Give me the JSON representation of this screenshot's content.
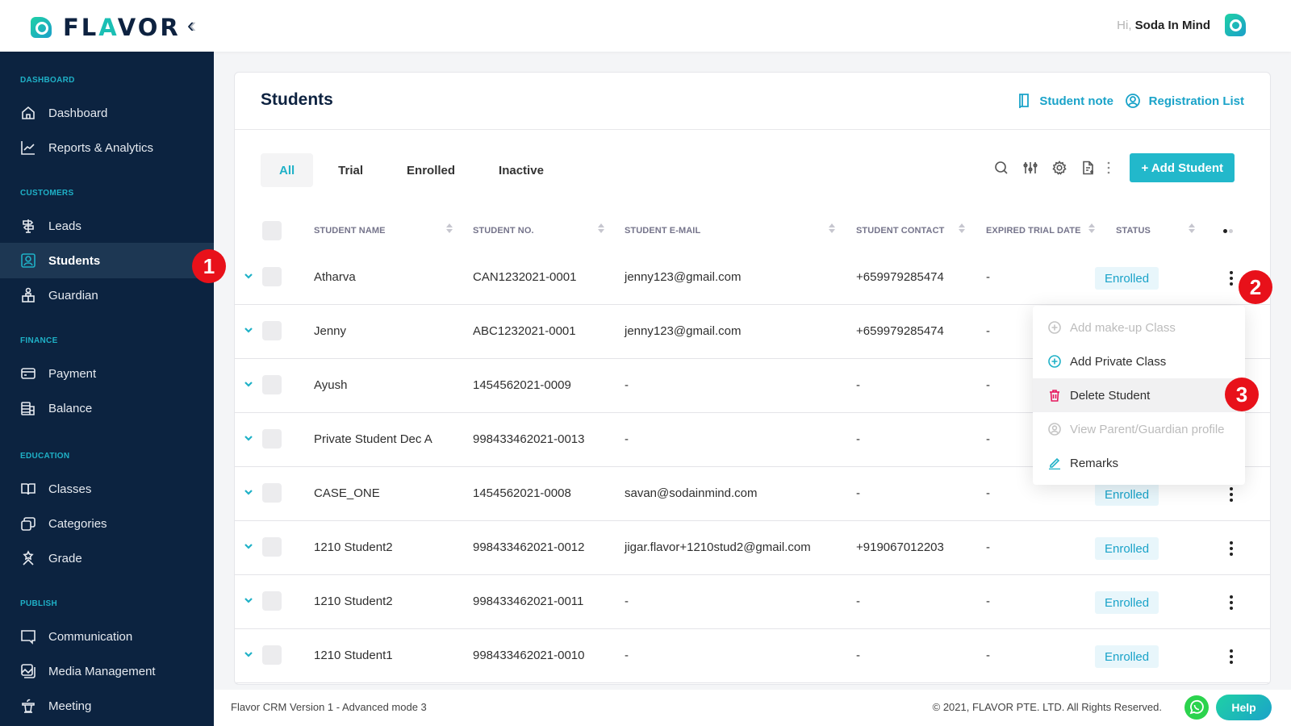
{
  "app": {
    "logo_text_pre": "FL",
    "logo_text_accent": "A",
    "logo_text_post": "VOR",
    "greeting_prefix": "Hi,",
    "user_name": "Soda In Mind"
  },
  "sidebar": {
    "sections": [
      {
        "title": "DASHBOARD",
        "items": [
          {
            "label": "Dashboard",
            "icon": "home-icon"
          },
          {
            "label": "Reports & Analytics",
            "icon": "chart-line-icon"
          }
        ]
      },
      {
        "title": "CUSTOMERS",
        "items": [
          {
            "label": "Leads",
            "icon": "signpost-icon"
          },
          {
            "label": "Students",
            "icon": "user-square-icon",
            "active": true
          },
          {
            "label": "Guardian",
            "icon": "guardian-icon"
          }
        ]
      },
      {
        "title": "FINANCE",
        "items": [
          {
            "label": "Payment",
            "icon": "credit-card-icon"
          },
          {
            "label": "Balance",
            "icon": "coins-stack-icon"
          }
        ]
      },
      {
        "title": "EDUCATION",
        "items": [
          {
            "label": "Classes",
            "icon": "book-open-icon"
          },
          {
            "label": "Categories",
            "icon": "layers-icon"
          },
          {
            "label": "Grade",
            "icon": "grade-icon"
          }
        ]
      },
      {
        "title": "PUBLISH",
        "items": [
          {
            "label": "Communication",
            "icon": "chat-icon"
          },
          {
            "label": "Media Management",
            "icon": "media-icon"
          },
          {
            "label": "Meeting",
            "icon": "podium-icon"
          }
        ]
      }
    ]
  },
  "annotations": [
    "1",
    "2",
    "3"
  ],
  "page": {
    "title": "Students",
    "student_note_label": "Student note",
    "registration_list_label": "Registration List",
    "tabs": [
      {
        "label": "All",
        "active": true
      },
      {
        "label": "Trial"
      },
      {
        "label": "Enrolled"
      },
      {
        "label": "Inactive"
      }
    ],
    "add_student_label": "+ Add Student"
  },
  "table": {
    "columns": [
      "STUDENT NAME",
      "STUDENT NO.",
      "STUDENT E-MAIL",
      "STUDENT CONTACT",
      "EXPIRED TRIAL DATE",
      "STATUS"
    ],
    "rows": [
      {
        "name": "Atharva",
        "no": "CAN1232021-0001",
        "email": "jenny123@gmail.com",
        "contact": "+659979285474",
        "expired": "-",
        "status": "Enrolled"
      },
      {
        "name": "Jenny",
        "no": "ABC1232021-0001",
        "email": "jenny123@gmail.com",
        "contact": "+659979285474",
        "expired": "-",
        "status": ""
      },
      {
        "name": "Ayush",
        "no": "1454562021-0009",
        "email": "-",
        "contact": "-",
        "expired": "-",
        "status": ""
      },
      {
        "name": "Private Student Dec A",
        "no": "998433462021-0013",
        "email": "-",
        "contact": "-",
        "expired": "-",
        "status": ""
      },
      {
        "name": "CASE_ONE",
        "no": "1454562021-0008",
        "email": "savan@sodainmind.com",
        "contact": "-",
        "expired": "-",
        "status": "Enrolled"
      },
      {
        "name": "1210 Student2",
        "no": "998433462021-0012",
        "email": "jigar.flavor+1210stud2@gmail.com",
        "contact": "+919067012203",
        "expired": "-",
        "status": "Enrolled"
      },
      {
        "name": "1210 Student2",
        "no": "998433462021-0011",
        "email": "-",
        "contact": "-",
        "expired": "-",
        "status": "Enrolled"
      },
      {
        "name": "1210 Student1",
        "no": "998433462021-0010",
        "email": "-",
        "contact": "-",
        "expired": "-",
        "status": "Enrolled"
      }
    ]
  },
  "row_menu": {
    "items": [
      {
        "label": "Add make-up Class",
        "icon": "plus-circle-icon",
        "disabled": true
      },
      {
        "label": "Add Private Class",
        "icon": "plus-circle-icon"
      },
      {
        "label": "Delete Student",
        "icon": "trash-icon",
        "hover": true
      },
      {
        "label": "View Parent/Guardian profile",
        "icon": "user-circle-icon",
        "disabled": true
      },
      {
        "label": "Remarks",
        "icon": "pencil-icon"
      }
    ]
  },
  "footer": {
    "version": "Flavor CRM Version 1 - Advanced mode 3",
    "copyright": "© 2021, FLAVOR PTE. LTD. All Rights Reserved.",
    "help_label": "Help"
  },
  "colors": {
    "accent": "#22b8cb",
    "sidebar_bg": "#0c2340",
    "status_bg": "#e8f6fb",
    "status_text": "#1aa3c9",
    "danger": "#e8111a",
    "delete_icon": "#e6175c"
  }
}
